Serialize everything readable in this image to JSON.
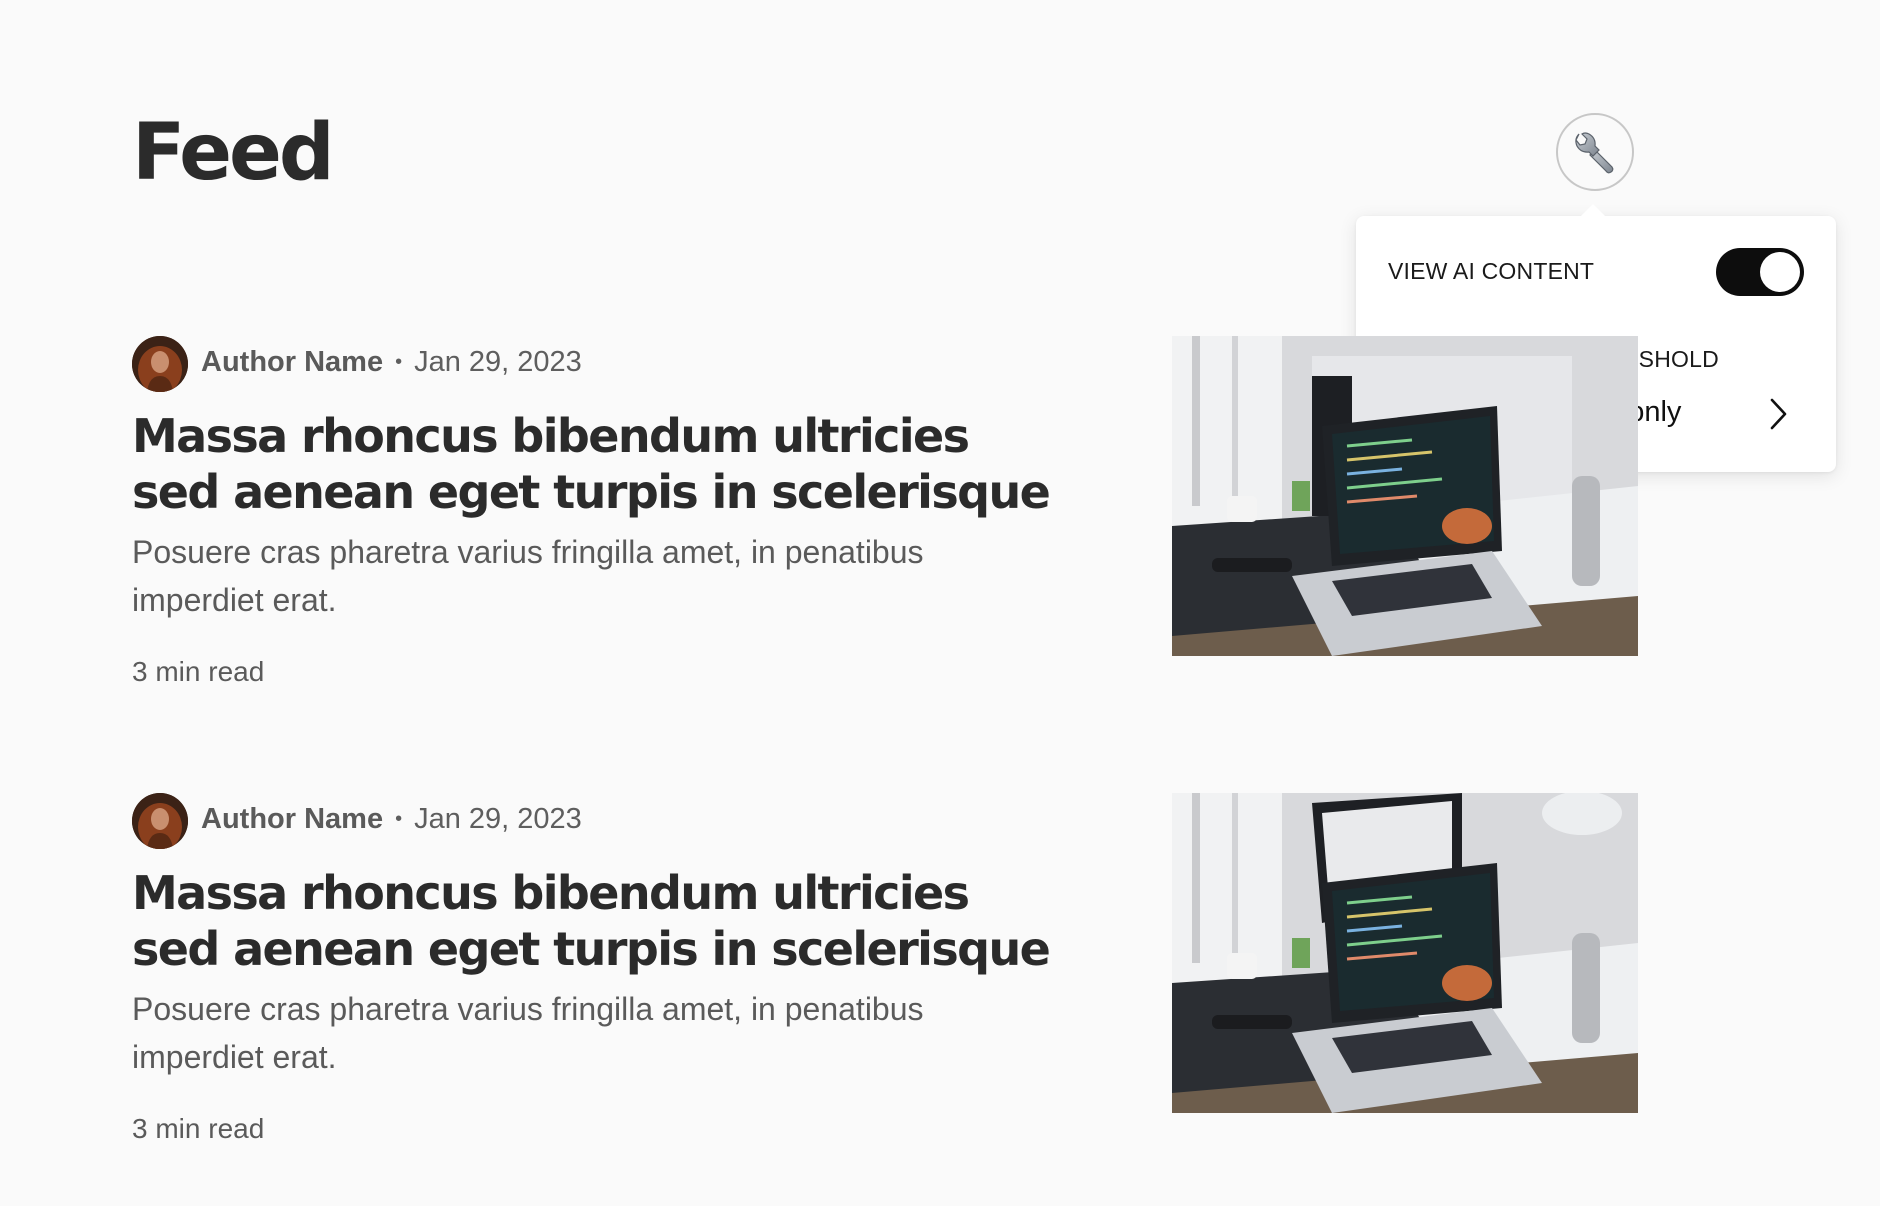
{
  "page": {
    "title": "Feed"
  },
  "settings": {
    "button_icon": "wrench-icon",
    "view_ai_label": "VIEW AI CONTENT",
    "view_ai_enabled": true,
    "threshold_label": "AI GENERATION THRESHOLD",
    "threshold_value": "Assisted only",
    "prev_icon": "chevron-left-icon",
    "next_icon": "chevron-right-icon"
  },
  "articles": [
    {
      "author": "Author Name",
      "date": "Jan 29, 2023",
      "title": "Massa rhoncus bibendum ultricies sed aenean eget turpis in scelerisque",
      "excerpt": "Posuere cras pharetra varius fringilla amet, in penatibus imperdiet erat.",
      "read_time": "3 min read"
    },
    {
      "author": "Author Name",
      "date": "Jan 29, 2023",
      "title": "Massa rhoncus bibendum ultricies sed aenean eget turpis in scelerisque",
      "excerpt": "Posuere cras pharetra varius fringilla amet, in penatibus imperdiet erat.",
      "read_time": "3 min read"
    }
  ],
  "colors": {
    "background": "#fafafa",
    "text": "#2b2b2b",
    "muted": "#5a5a5a",
    "toggle_on": "#0d0d0d"
  }
}
